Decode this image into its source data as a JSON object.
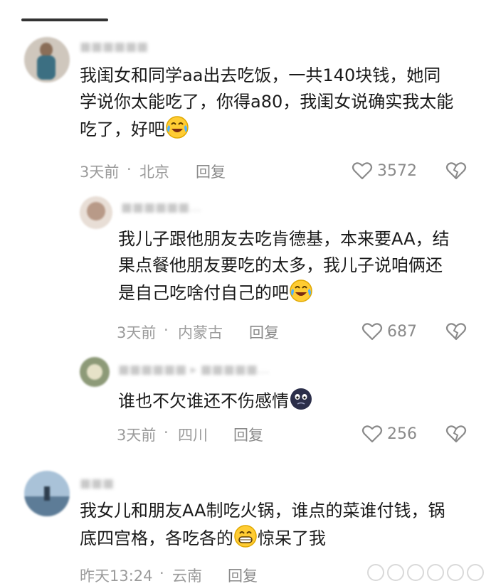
{
  "comments": [
    {
      "text": "我闺女和同学aa出去吃饭，一共140块钱，她同学说你太能吃了，你得a80，我闺女说确实我太能吃了，好吧",
      "emoji": "laugh-cry",
      "time": "3天前",
      "location": "北京",
      "reply_label": "回复",
      "likes": "3572",
      "replies": [
        {
          "text": "我儿子跟他朋友去吃肯德基，本来要AA，结果点餐他朋友要吃的太多，我儿子说咱俩还是自己吃啥付自己的吧",
          "emoji": "laugh-cry",
          "time": "3天前",
          "location": "内蒙古",
          "reply_label": "回复",
          "likes": "687"
        },
        {
          "text": "谁也不欠谁还不伤感情",
          "emoji": "dark-blob",
          "time": "3天前",
          "location": "四川",
          "reply_label": "回复",
          "likes": "256"
        }
      ]
    },
    {
      "text_before": "我女儿和朋友AA制吃火锅，谁点的菜谁付钱，锅底四宫格，各吃各的",
      "emoji": "grin",
      "text_after": "惊呆了我",
      "time": "昨天13:24",
      "location": "云南",
      "reply_label": "回复"
    }
  ],
  "separator": "·",
  "colors": {
    "text": "#1a1a1a",
    "meta": "#9b9b9b",
    "icon": "#8a8a8a"
  }
}
